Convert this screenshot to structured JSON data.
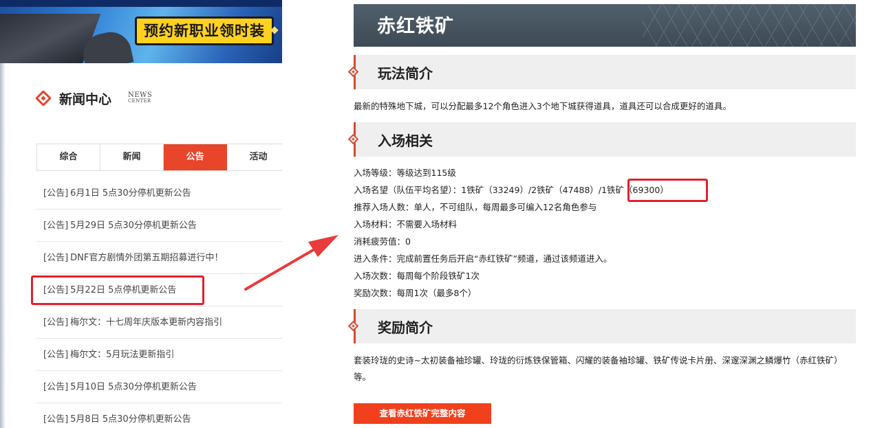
{
  "banner": {
    "cta": "预约新职业领时装"
  },
  "news_center": {
    "title": "新闻中心",
    "subtitle_line1": "NEWS",
    "subtitle_line2": "CENTER",
    "tabs": [
      "综合",
      "新闻",
      "公告",
      "活动"
    ],
    "active_tab": "公告",
    "items": [
      {
        "tag": "[公告]",
        "text": "6月1日 5点30分停机更新公告"
      },
      {
        "tag": "[公告]",
        "text": "5月29日 5点30分停机更新公告"
      },
      {
        "tag": "[公告]",
        "text": "DNF官方剧情外团第五期招募进行中！"
      },
      {
        "tag": "[公告]",
        "text": "5月22日 5点停机更新公告"
      },
      {
        "tag": "[公告]",
        "text": "梅尔文：十七周年庆版本更新内容指引"
      },
      {
        "tag": "[公告]",
        "text": "梅尔文：5月玩法更新指引"
      },
      {
        "tag": "[公告]",
        "text": "5月10日 5点30分停机更新公告"
      },
      {
        "tag": "[公告]",
        "text": "5月8日 5点30分停机更新公告"
      }
    ]
  },
  "dungeon": {
    "title": "赤红铁矿",
    "sections": {
      "intro": {
        "title": "玩法简介",
        "text": "最新的特殊地下城，可以分配最多12个角色进入3个地下城获得道具，道具还可以合成更好的道具。"
      },
      "entry": {
        "title": "入场相关",
        "lines": [
          "入场等级：等级达到115级",
          "入场名望（队伍平均名望）：1铁矿（33249）/2铁矿（47488）/1铁矿（69300）",
          "推荐入场人数：单人，不可组队，每周最多可编入12名角色参与",
          "入场材料：不需要入场材料",
          "消耗疲劳值：0",
          "进入条件：完成前置任务后开启“赤红铁矿”频道，通过该频道进入。",
          "入场次数：每周每个阶段铁矿1次",
          "奖励次数：每周1次（最多8个）"
        ]
      },
      "rewards": {
        "title": "奖励简介",
        "text": "套装玲珑的史诗~太初装备袖珍罐、玲珑的衍炼铁保管箱、闪耀的装备袖珍罐、铁矿传说卡片册、深邃深渊之鳞爆竹（赤红铁矿）等。"
      }
    },
    "button_label": "查看赤红铁矿完整内容"
  },
  "colors": {
    "accent_red": "#e8452a",
    "highlight_red": "#e2202c",
    "title_bar": "#465360",
    "section_bg": "#efefef"
  }
}
